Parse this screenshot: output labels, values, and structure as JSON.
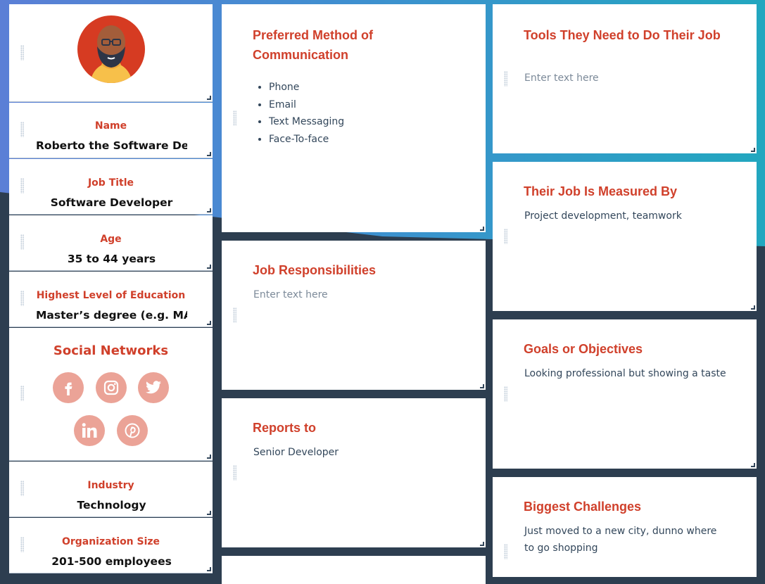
{
  "profile": {
    "avatar_alt": "avatar"
  },
  "fields": {
    "name": {
      "label": "Name",
      "value": "Roberto the Software Developer"
    },
    "job_title": {
      "label": "Job Title",
      "value": "Software Developer"
    },
    "age": {
      "label": "Age",
      "value": "35 to 44 years"
    },
    "education": {
      "label": "Highest Level of Education",
      "value": "Master’s degree (e.g. MA, MS, MEng, MBA)"
    },
    "industry": {
      "label": "Industry",
      "value": "Technology"
    },
    "org_size": {
      "label": "Organization Size",
      "value": "201-500 employees"
    }
  },
  "social": {
    "title": "Social Networks",
    "icons": [
      "facebook-icon",
      "instagram-icon",
      "twitter-icon",
      "linkedin-icon",
      "pinterest-icon"
    ]
  },
  "cards": {
    "communication": {
      "title": "Preferred Method of Communication",
      "items": [
        "Phone",
        "Email",
        "Text Messaging",
        "Face-To-face"
      ]
    },
    "responsibilities": {
      "title": "Job Responsibilities",
      "body": "Enter text here"
    },
    "reports_to": {
      "title": "Reports to",
      "body": "Senior Developer"
    },
    "tools": {
      "title": "Tools They Need to Do Their Job",
      "body": "Enter text here"
    },
    "measured_by": {
      "title": "Their Job Is Measured By",
      "body": "Project development, teamwork"
    },
    "goals": {
      "title": "Goals or Objectives",
      "body": "Looking professional but showing a taste"
    },
    "challenges": {
      "title": "Biggest Challenges",
      "body": "Just moved to a new city, dunno where to go shopping"
    }
  },
  "colors": {
    "accent": "#d0402b",
    "social_icon_bg": "#eba397",
    "background_dark": "#2d3e50"
  }
}
